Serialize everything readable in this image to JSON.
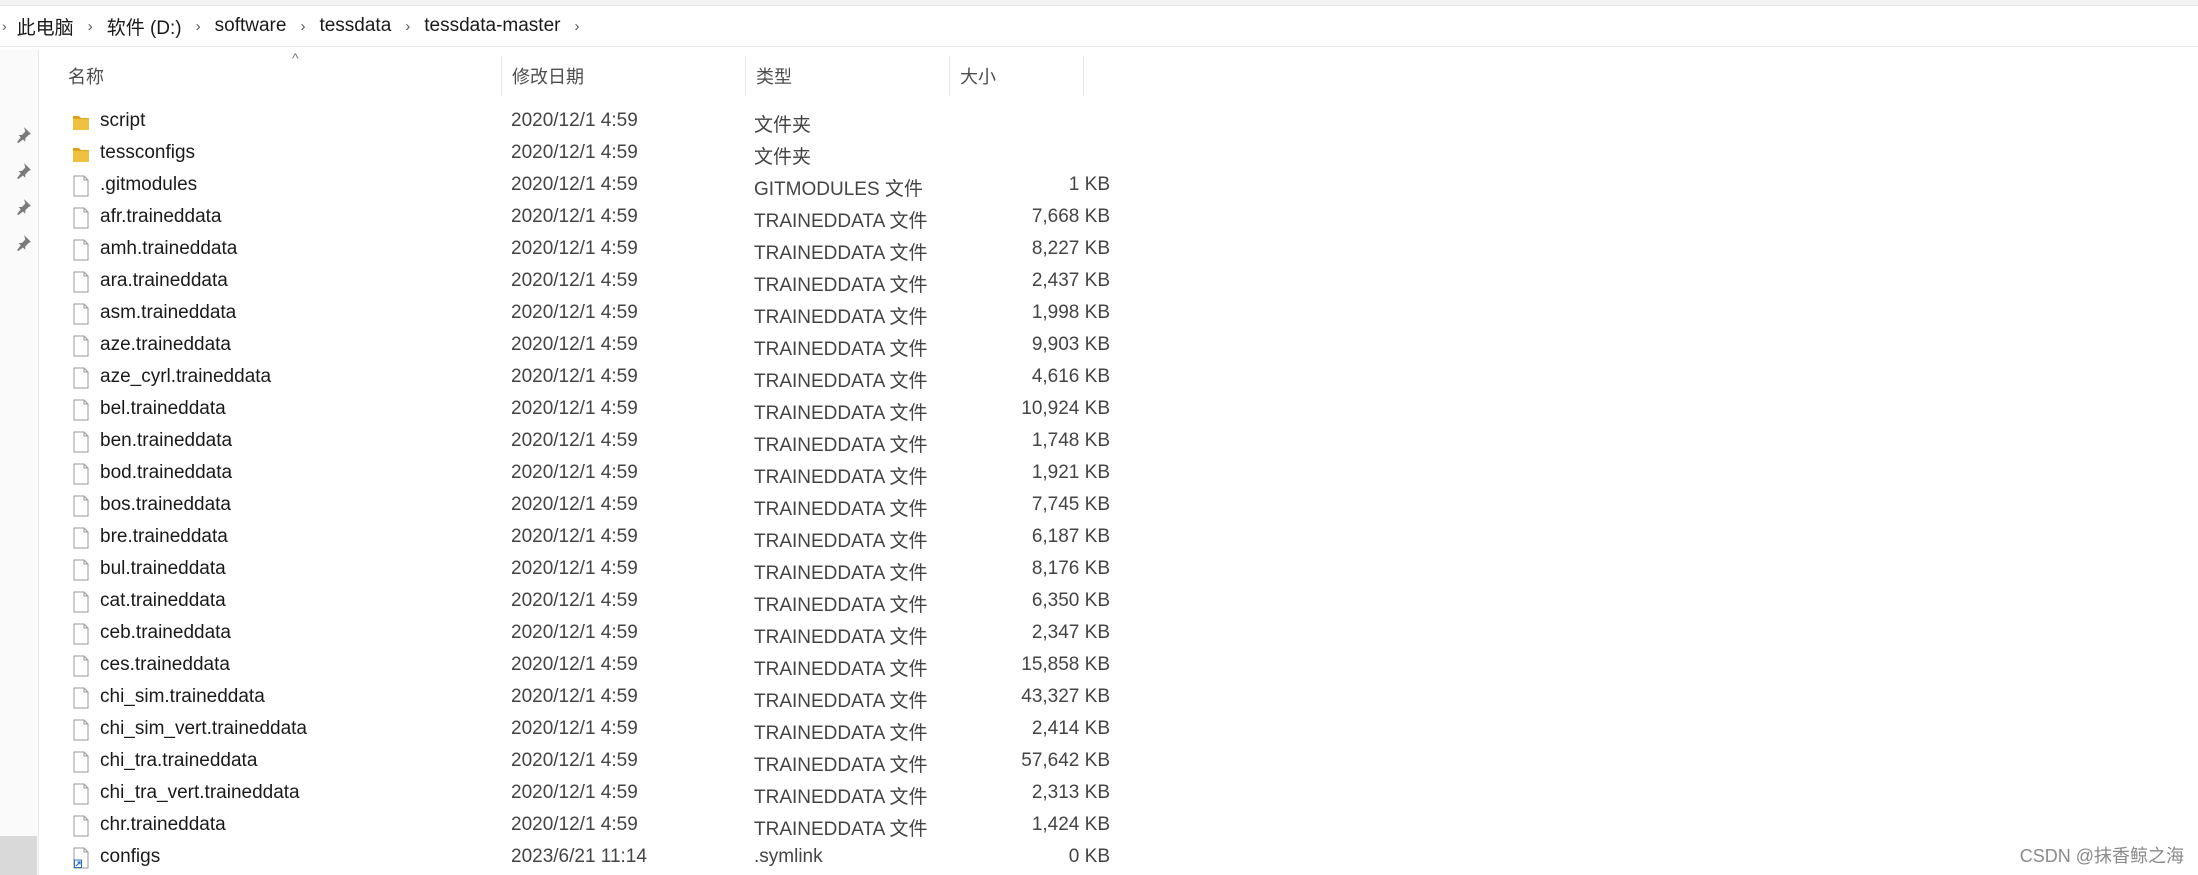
{
  "breadcrumb": [
    "此电脑",
    "软件 (D:)",
    "software",
    "tessdata",
    "tessdata-master"
  ],
  "columns": {
    "name": "名称",
    "date": "修改日期",
    "type": "类型",
    "size": "大小"
  },
  "rows": [
    {
      "name": "script",
      "date": "2020/12/1 4:59",
      "type": "文件夹",
      "size": "",
      "icon": "folder-icon"
    },
    {
      "name": "tessconfigs",
      "date": "2020/12/1 4:59",
      "type": "文件夹",
      "size": "",
      "icon": "folder-icon"
    },
    {
      "name": ".gitmodules",
      "date": "2020/12/1 4:59",
      "type": "GITMODULES 文件",
      "size": "1 KB",
      "icon": "file-icon"
    },
    {
      "name": "afr.traineddata",
      "date": "2020/12/1 4:59",
      "type": "TRAINEDDATA 文件",
      "size": "7,668 KB",
      "icon": "file-icon"
    },
    {
      "name": "amh.traineddata",
      "date": "2020/12/1 4:59",
      "type": "TRAINEDDATA 文件",
      "size": "8,227 KB",
      "icon": "file-icon"
    },
    {
      "name": "ara.traineddata",
      "date": "2020/12/1 4:59",
      "type": "TRAINEDDATA 文件",
      "size": "2,437 KB",
      "icon": "file-icon"
    },
    {
      "name": "asm.traineddata",
      "date": "2020/12/1 4:59",
      "type": "TRAINEDDATA 文件",
      "size": "1,998 KB",
      "icon": "file-icon"
    },
    {
      "name": "aze.traineddata",
      "date": "2020/12/1 4:59",
      "type": "TRAINEDDATA 文件",
      "size": "9,903 KB",
      "icon": "file-icon"
    },
    {
      "name": "aze_cyrl.traineddata",
      "date": "2020/12/1 4:59",
      "type": "TRAINEDDATA 文件",
      "size": "4,616 KB",
      "icon": "file-icon"
    },
    {
      "name": "bel.traineddata",
      "date": "2020/12/1 4:59",
      "type": "TRAINEDDATA 文件",
      "size": "10,924 KB",
      "icon": "file-icon"
    },
    {
      "name": "ben.traineddata",
      "date": "2020/12/1 4:59",
      "type": "TRAINEDDATA 文件",
      "size": "1,748 KB",
      "icon": "file-icon"
    },
    {
      "name": "bod.traineddata",
      "date": "2020/12/1 4:59",
      "type": "TRAINEDDATA 文件",
      "size": "1,921 KB",
      "icon": "file-icon"
    },
    {
      "name": "bos.traineddata",
      "date": "2020/12/1 4:59",
      "type": "TRAINEDDATA 文件",
      "size": "7,745 KB",
      "icon": "file-icon"
    },
    {
      "name": "bre.traineddata",
      "date": "2020/12/1 4:59",
      "type": "TRAINEDDATA 文件",
      "size": "6,187 KB",
      "icon": "file-icon"
    },
    {
      "name": "bul.traineddata",
      "date": "2020/12/1 4:59",
      "type": "TRAINEDDATA 文件",
      "size": "8,176 KB",
      "icon": "file-icon"
    },
    {
      "name": "cat.traineddata",
      "date": "2020/12/1 4:59",
      "type": "TRAINEDDATA 文件",
      "size": "6,350 KB",
      "icon": "file-icon"
    },
    {
      "name": "ceb.traineddata",
      "date": "2020/12/1 4:59",
      "type": "TRAINEDDATA 文件",
      "size": "2,347 KB",
      "icon": "file-icon"
    },
    {
      "name": "ces.traineddata",
      "date": "2020/12/1 4:59",
      "type": "TRAINEDDATA 文件",
      "size": "15,858 KB",
      "icon": "file-icon"
    },
    {
      "name": "chi_sim.traineddata",
      "date": "2020/12/1 4:59",
      "type": "TRAINEDDATA 文件",
      "size": "43,327 KB",
      "icon": "file-icon"
    },
    {
      "name": "chi_sim_vert.traineddata",
      "date": "2020/12/1 4:59",
      "type": "TRAINEDDATA 文件",
      "size": "2,414 KB",
      "icon": "file-icon"
    },
    {
      "name": "chi_tra.traineddata",
      "date": "2020/12/1 4:59",
      "type": "TRAINEDDATA 文件",
      "size": "57,642 KB",
      "icon": "file-icon"
    },
    {
      "name": "chi_tra_vert.traineddata",
      "date": "2020/12/1 4:59",
      "type": "TRAINEDDATA 文件",
      "size": "2,313 KB",
      "icon": "file-icon"
    },
    {
      "name": "chr.traineddata",
      "date": "2020/12/1 4:59",
      "type": "TRAINEDDATA 文件",
      "size": "1,424 KB",
      "icon": "file-icon"
    },
    {
      "name": "configs",
      "date": "2023/6/21 11:14",
      "type": ".symlink",
      "size": "0 KB",
      "icon": "symlink-file-icon"
    }
  ],
  "watermark": "CSDN @抹香鲸之海",
  "colors": {
    "folder": "#f0c040",
    "folder_dark": "#d9a520",
    "symlink": "#2b6cc4"
  }
}
